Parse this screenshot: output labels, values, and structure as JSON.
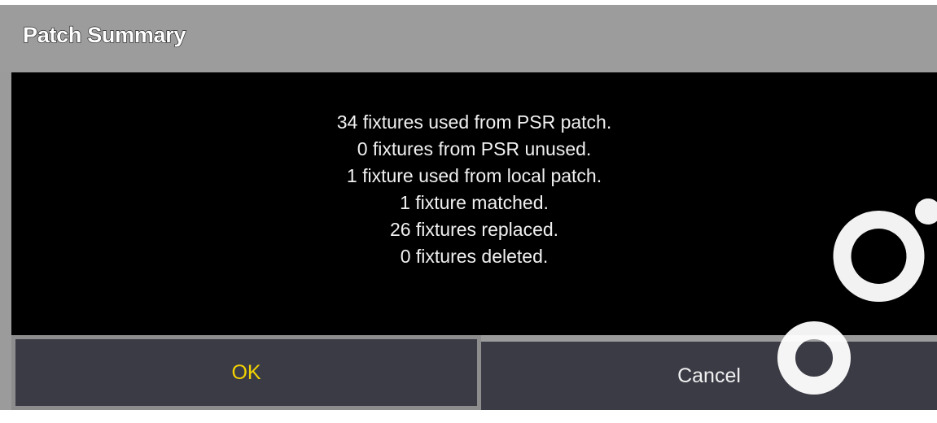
{
  "dialog": {
    "title": "Patch Summary",
    "messages": [
      "34 fixtures used from PSR patch.",
      "0 fixtures from PSR unused.",
      "1 fixture used from local patch.",
      "1 fixture matched.",
      "26 fixtures replaced.",
      "0 fixtures deleted."
    ],
    "buttons": {
      "ok_label": "OK",
      "cancel_label": "Cancel"
    }
  },
  "colors": {
    "title_bar": "#9c9c9c",
    "body_background": "#000000",
    "button_background": "#3b3b46",
    "ok_text": "#f2d200",
    "message_text": "#f0f0f0"
  },
  "watermark": {
    "icon": "watermark-logo-icon"
  }
}
